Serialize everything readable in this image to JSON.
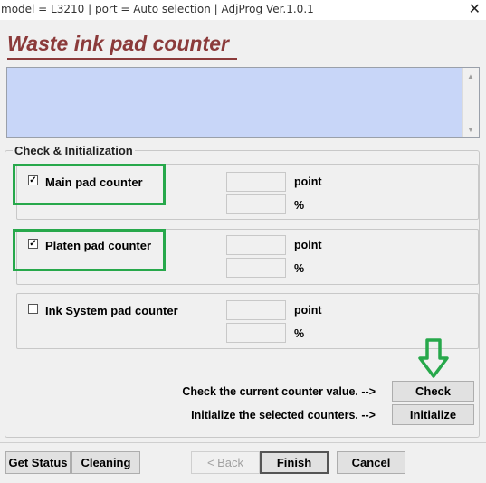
{
  "window": {
    "title": "model = L3210 | port = Auto selection | AdjProg Ver.1.0.1",
    "close_glyph": "✕"
  },
  "header": {
    "title": "Waste ink pad counter"
  },
  "group": {
    "title": "Check & Initialization"
  },
  "counters": [
    {
      "label": "Main pad counter",
      "checked": true,
      "check_glyph": "✓",
      "unit_point": "point",
      "unit_percent": "%",
      "point_value": "",
      "percent_value": ""
    },
    {
      "label": "Platen pad counter",
      "checked": true,
      "check_glyph": "✓",
      "unit_point": "point",
      "unit_percent": "%",
      "point_value": "",
      "percent_value": ""
    },
    {
      "label": "Ink System pad counter",
      "checked": false,
      "check_glyph": "",
      "unit_point": "point",
      "unit_percent": "%",
      "point_value": "",
      "percent_value": ""
    }
  ],
  "actions": {
    "check_hint": "Check the current counter value. -->",
    "check_label": "Check",
    "init_hint": "Initialize the selected counters. -->",
    "init_label": "Initialize"
  },
  "footer": {
    "get_status": "Get Status",
    "cleaning": "Cleaning",
    "back": "< Back",
    "finish": "Finish",
    "cancel": "Cancel"
  },
  "colors": {
    "title": "#8b3a3a",
    "log_background": "#c8d6f8",
    "highlight": "#27a84b"
  },
  "icons": {
    "scroll_up": "▲",
    "scroll_down": "▼"
  }
}
